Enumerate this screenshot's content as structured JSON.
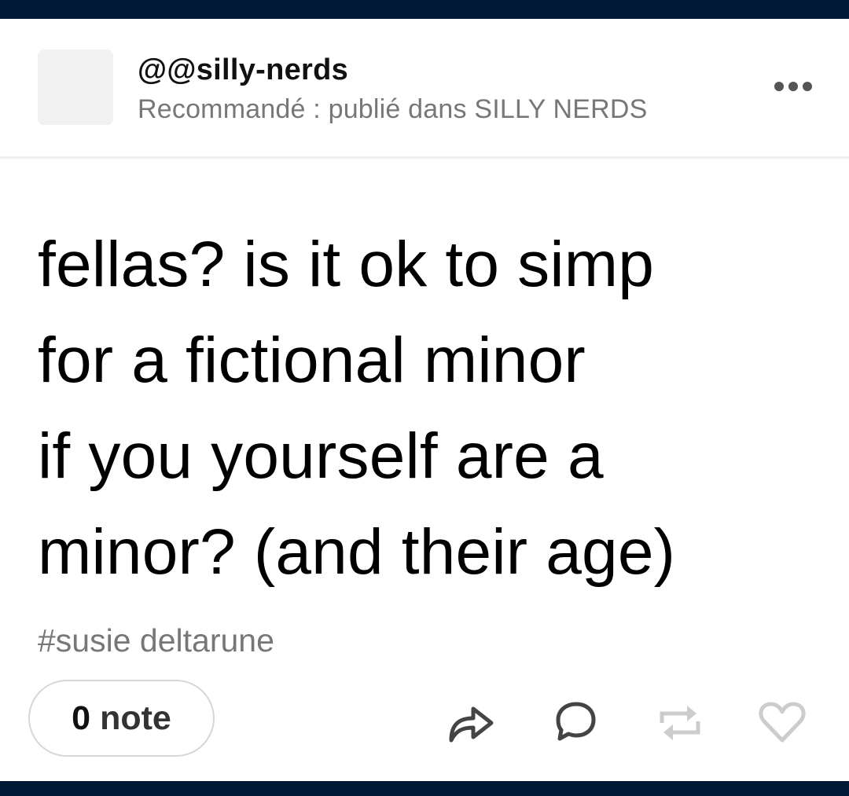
{
  "post": {
    "username": "@@silly-nerds",
    "subtitle": "Recommandé : publié dans SILLY NERDS",
    "text": "fellas? is it ok to simp\nfor a fictional minor\nif you yourself are a\nminor? (and their age)",
    "tag": "#susie deltarune"
  },
  "footer": {
    "notes_count": "0",
    "notes_label": "note",
    "actions": [
      "share-icon",
      "reply-icon",
      "reblog-icon",
      "like-icon"
    ]
  },
  "colors": {
    "frame": "#001935",
    "muted_text": "#777777",
    "disabled_icon": "#cccccc"
  }
}
